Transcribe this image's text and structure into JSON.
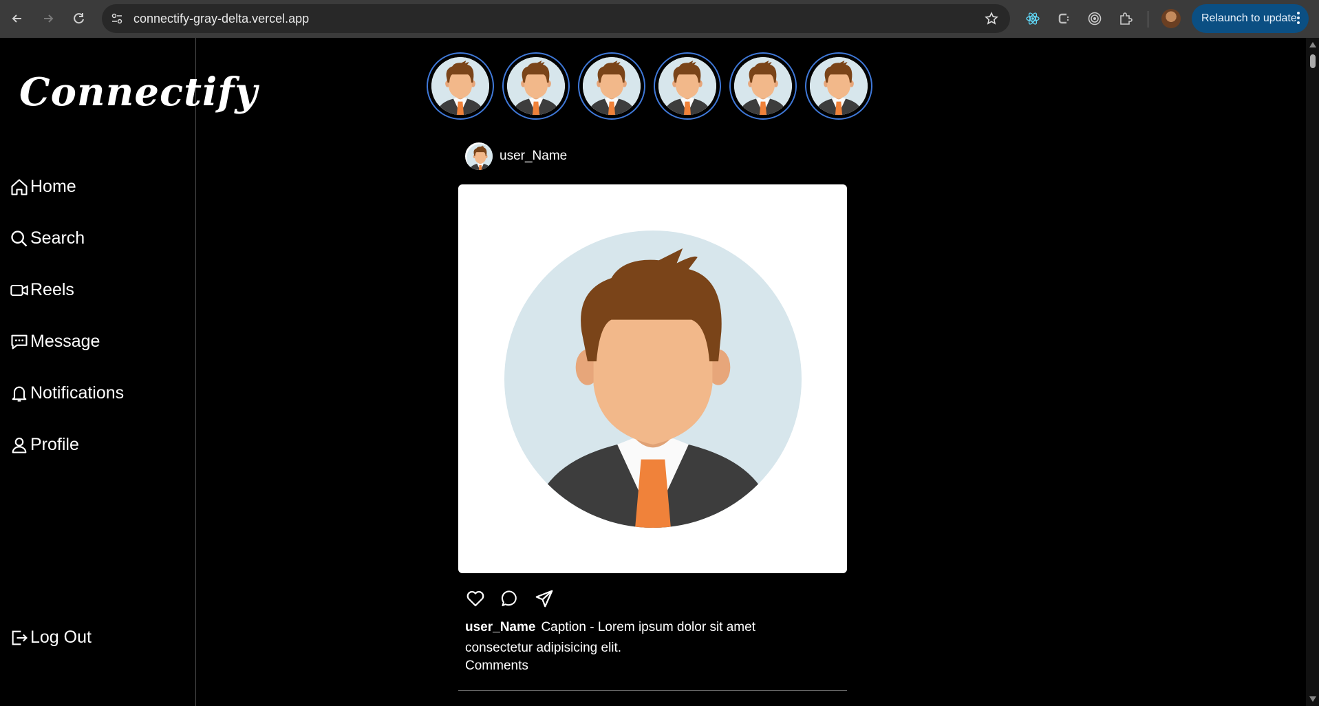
{
  "browser": {
    "url": "connectify-gray-delta.vercel.app",
    "relaunch_label": "Relaunch to update"
  },
  "app": {
    "logo": "Connectify"
  },
  "sidebar": {
    "items": [
      {
        "label": "Home",
        "icon": "home-icon"
      },
      {
        "label": "Search",
        "icon": "search-icon"
      },
      {
        "label": "Reels",
        "icon": "video-icon"
      },
      {
        "label": "Message",
        "icon": "message-icon"
      },
      {
        "label": "Notifications",
        "icon": "bell-icon"
      },
      {
        "label": "Profile",
        "icon": "user-icon"
      }
    ],
    "logout_label": "Log Out"
  },
  "stories": {
    "count": 6
  },
  "post": {
    "username": "user_Name",
    "caption_user": "user_Name",
    "caption": "Caption - Lorem ipsum dolor sit amet consectetur adipisicing elit.",
    "comments_label": "Comments"
  },
  "colors": {
    "background": "#000000",
    "story_ring": "#3f78d8",
    "relaunch_bg": "#0b4f83",
    "avatar_bg": "#d7e6ec",
    "hair": "#7a4419",
    "skin": "#f2b88a",
    "suit": "#3d3d3d",
    "tie": "#f0823a"
  }
}
